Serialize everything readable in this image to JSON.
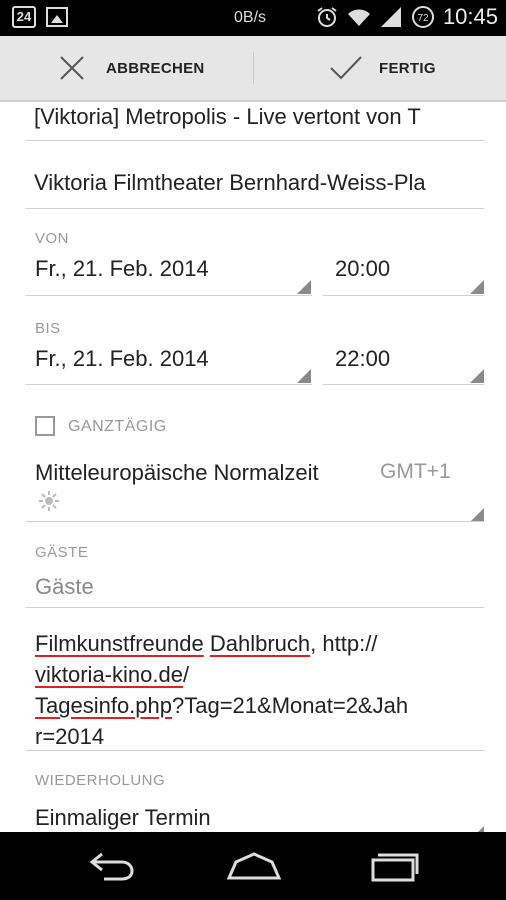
{
  "status_bar": {
    "date_badge": "24",
    "net_speed": "0B/s",
    "battery_level": "72",
    "time": "10:45"
  },
  "action_bar": {
    "cancel_label": "ABBRECHEN",
    "done_label": "FERTIG"
  },
  "form": {
    "title": "[Viktoria] Metropolis - Live vertont von T",
    "location": "Viktoria Filmtheater Bernhard-Weiss-Pla",
    "from": {
      "label": "VON",
      "date": "Fr., 21. Feb. 2014",
      "time": "20:00"
    },
    "to": {
      "label": "BIS",
      "date": "Fr., 21. Feb. 2014",
      "time": "22:00"
    },
    "all_day": {
      "label": "GANZTÄGIG",
      "checked": false
    },
    "timezone": {
      "name": "Mitteleuropäische Normalzeit",
      "offset": "GMT+1",
      "icon": "sun-icon"
    },
    "guests": {
      "label": "GÄSTE",
      "placeholder": "Gäste"
    },
    "description": {
      "line1_a": "Filmkunstfreunde",
      "line1_b": "Dahlbruch",
      "line1_c": ", http://",
      "line2_a": "viktoria-kino.de",
      "line2_b": "/",
      "line3_a": "Tagesinfo.php",
      "line3_b": "?Tag=21&Monat=2&Jah",
      "line4": "r=2014"
    },
    "repeat": {
      "label": "WIEDERHOLUNG",
      "value": "Einmaliger Termin"
    }
  },
  "colors": {
    "status_bar_bg": "#000000",
    "action_bar_bg": "#e6e6e6",
    "spell_underline": "#e02020"
  }
}
